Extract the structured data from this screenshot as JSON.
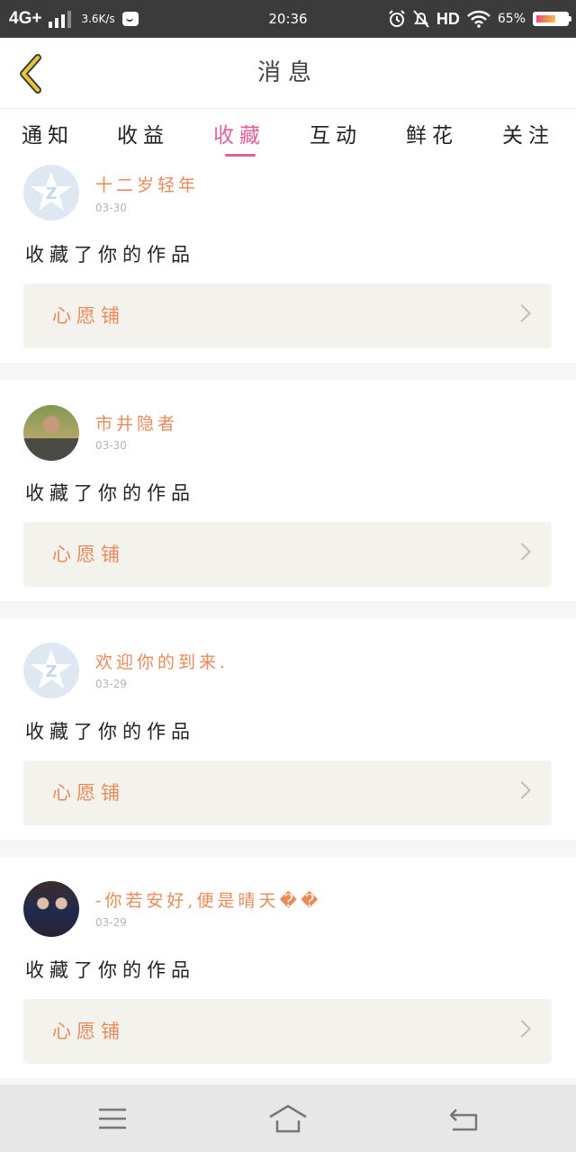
{
  "status_bar": {
    "network": "4G+",
    "speed": "3.6K/s",
    "time": "20:36",
    "hd": "HD",
    "battery": "65%",
    "battery_level": 0.65
  },
  "header": {
    "title": "消息",
    "back_icon": "chevron-left-icon",
    "accent_color": "#e9c53b"
  },
  "tabs": [
    {
      "label": "通知"
    },
    {
      "label": "收益"
    },
    {
      "label": "收藏"
    },
    {
      "label": "互动"
    },
    {
      "label": "鲜花"
    },
    {
      "label": "关注"
    }
  ],
  "active_tab": "收藏",
  "messages": [
    {
      "name": "十二岁轻年",
      "date": "03-30",
      "action": "收藏了你的作品",
      "work": "心愿铺",
      "avatar": "default-avatar"
    },
    {
      "name": "市井隐者",
      "date": "03-30",
      "action": "收藏了你的作品",
      "work": "心愿铺",
      "avatar": "photo-avatar"
    },
    {
      "name": "欢迎你的到来.",
      "date": "03-29",
      "action": "收藏了你的作品",
      "work": "心愿铺",
      "avatar": "default-avatar"
    },
    {
      "name": "-你若安好,便是晴天��",
      "date": "03-29",
      "action": "收藏了你的作品",
      "work": "心愿铺",
      "avatar": "photo-avatar"
    }
  ],
  "colors": {
    "name": "#e98a5a",
    "active_tab": "#e0609a",
    "work_bg": "#f3f2ec"
  },
  "nav_bar": {
    "icons": [
      "menu-icon",
      "home-icon",
      "back-icon"
    ]
  }
}
